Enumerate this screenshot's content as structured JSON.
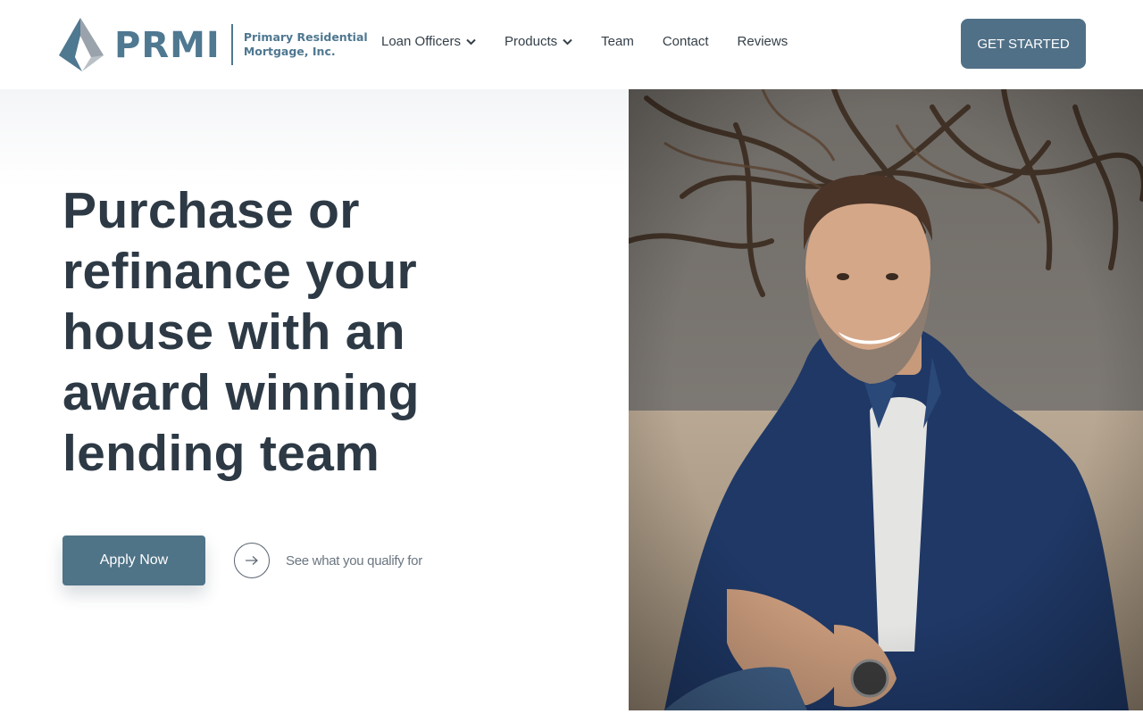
{
  "logo": {
    "wordmark": "PRMI",
    "line1": "Primary Residential",
    "line2": "Mortgage, Inc."
  },
  "nav": {
    "items": [
      {
        "label": "Loan Officers",
        "has_dropdown": true
      },
      {
        "label": "Products",
        "has_dropdown": true
      },
      {
        "label": "Team",
        "has_dropdown": false
      },
      {
        "label": "Contact",
        "has_dropdown": false
      },
      {
        "label": "Reviews",
        "has_dropdown": false
      }
    ]
  },
  "header": {
    "cta_label": "GET STARTED"
  },
  "hero": {
    "headline_lines": [
      "Purchase or",
      "refinance your",
      "house with an",
      "award winning",
      "lending team"
    ],
    "apply_label": "Apply Now",
    "qualify_label": "See what you qualify for",
    "photo_subject": "smiling man in blue blazer"
  },
  "colors": {
    "brand": "#507087",
    "heading": "#2d3a45",
    "nav_text": "#343f48",
    "muted_text": "#6a7580"
  },
  "icons": {
    "dropdown": "chevron-down-icon",
    "qualify": "arrow-right-icon"
  }
}
